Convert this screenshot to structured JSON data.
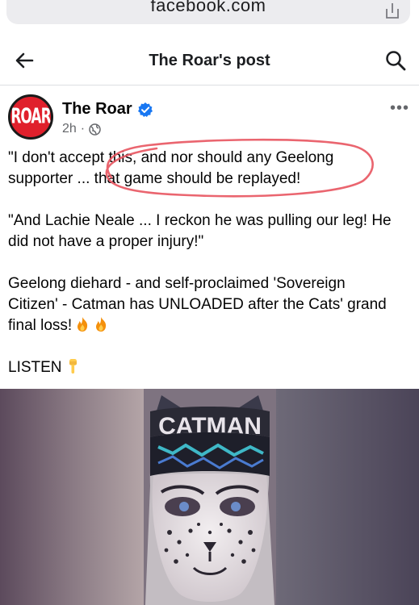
{
  "browser": {
    "url_text": "facebook.com",
    "share_icon": "share-icon"
  },
  "nav": {
    "title": "The Roar's post",
    "back_icon": "back-arrow-icon",
    "search_icon": "search-icon"
  },
  "post": {
    "author": "The Roar",
    "avatar_text": "ROAR",
    "verified_icon": "verified-badge-icon",
    "time": "2h",
    "meta_separator": "·",
    "audience_icon": "globe-icon",
    "more_label": "•••",
    "paragraphs": [
      "\"I don't accept this, and nor should any Geelong supporter ... that game should be replayed!",
      "\"And Lachie Neale ... I reckon he was pulling our leg! He did not have a proper injury!\"",
      "Geelong diehard - and self-proclaimed 'Sovereign Citizen' - Catman has UNLOADED after the Cats' grand final loss!",
      "LISTEN"
    ],
    "emoji": {
      "fire": "fire-emoji",
      "point_down": "backhand-index-pointing-down-emoji"
    }
  },
  "video": {
    "headband_text": "CATMAN"
  },
  "colors": {
    "brand_red": "#e0202c",
    "verified_blue": "#1877f2",
    "highlight_ring": "#e8545f",
    "muted_text": "#65676b"
  }
}
